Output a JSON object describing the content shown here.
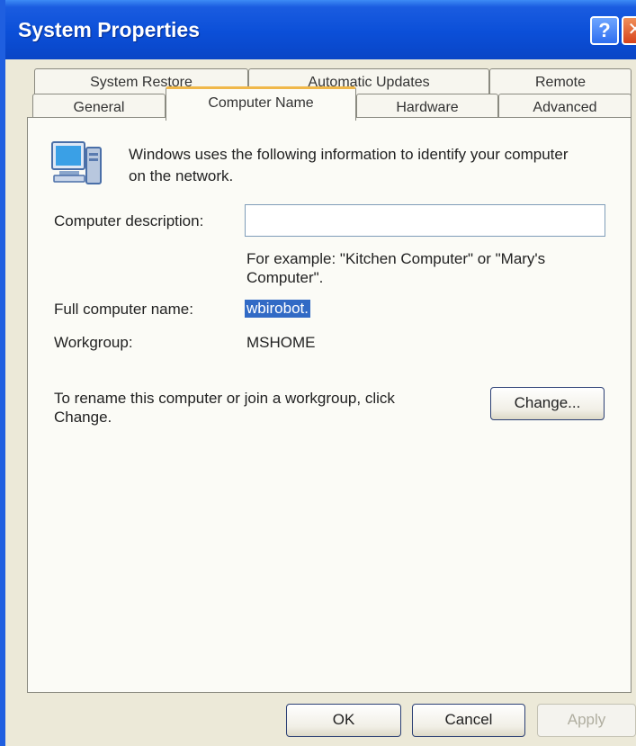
{
  "window": {
    "title": "System Properties",
    "help_glyph": "?",
    "close_glyph": "✕"
  },
  "tabs": {
    "row1": [
      "System Restore",
      "Automatic Updates",
      "Remote"
    ],
    "row2": [
      "General",
      "Computer Name",
      "Hardware",
      "Advanced"
    ],
    "active": "Computer Name"
  },
  "content": {
    "intro_line1": "Windows uses the following information to identify your computer",
    "intro_line2": "on the network.",
    "description_label": "Computer description:",
    "description_value": "",
    "example_line1": "For example: \"Kitchen Computer\" or \"Mary's",
    "example_line2": "Computer\".",
    "full_name_label": "Full computer name:",
    "full_name_value": "wbirobot.",
    "workgroup_label": "Workgroup:",
    "workgroup_value": "MSHOME",
    "rename_line1": "To rename this computer or join a workgroup, click",
    "rename_line2": "Change.",
    "change_button": "Change..."
  },
  "footer": {
    "ok": "OK",
    "cancel": "Cancel",
    "apply": "Apply"
  },
  "colors": {
    "titlebar": "#0b4fd8",
    "face": "#ece9d8",
    "selection": "#316ac5",
    "active_tab_accent": "#f0b84a"
  },
  "icons": [
    "help-icon",
    "close-icon",
    "computer-icon"
  ]
}
